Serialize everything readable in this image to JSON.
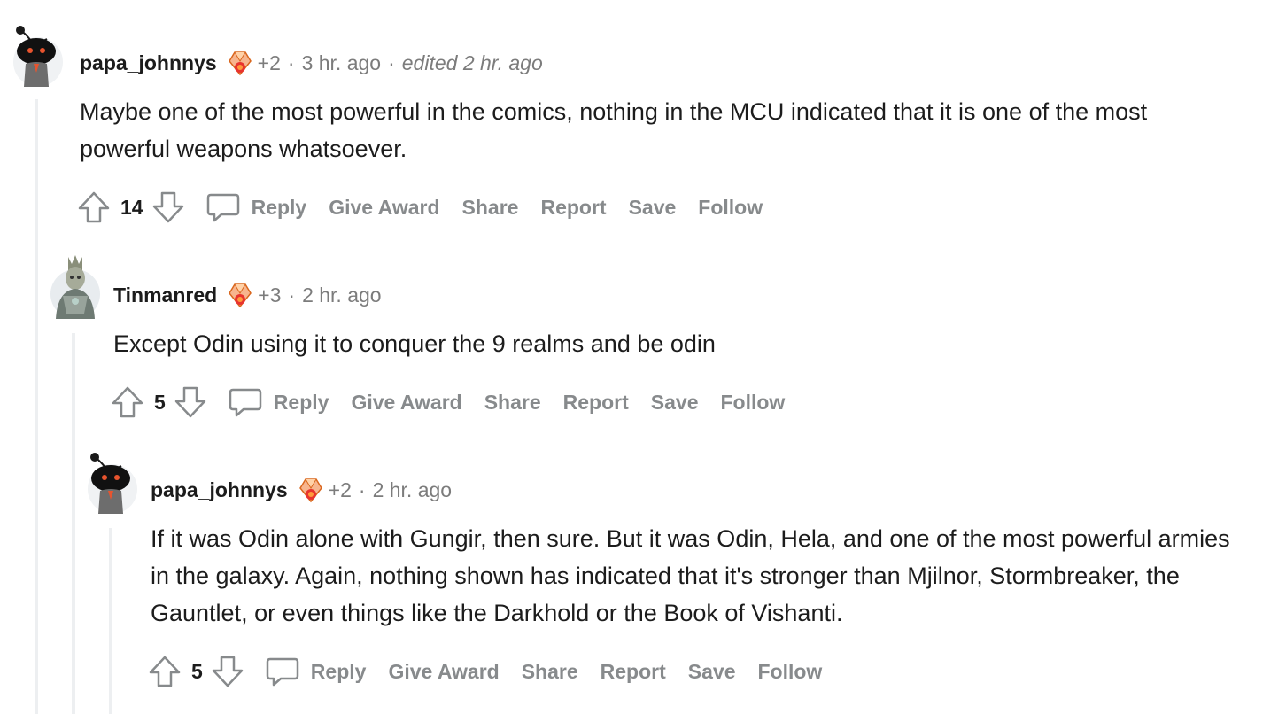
{
  "comments": [
    {
      "username": "papa_johnnys",
      "flair_score": "+2",
      "time": "3 hr. ago",
      "edited": "edited 2 hr. ago",
      "body": "Maybe one of the most powerful in the comics, nothing in the MCU indicated that it is one of the most powerful weapons whatsoever.",
      "score": "14",
      "avatar_icon": "snoo-avatar-icon"
    },
    {
      "username": "Tinmanred",
      "flair_score": "+3",
      "time": "2 hr. ago",
      "edited": "",
      "body": "Except Odin using it to conquer the 9 realms and be odin",
      "score": "5",
      "avatar_icon": "armored-character-avatar-icon"
    },
    {
      "username": "papa_johnnys",
      "flair_score": "+2",
      "time": "2 hr. ago",
      "edited": "",
      "body": "If it was Odin alone with Gungir, then sure. But it was Odin, Hela, and one of the most powerful armies in the galaxy. Again, nothing shown has indicated that it's stronger than Mjilnor, Stormbreaker, the Gauntlet, or even things like the Darkhold or the Book of Vishanti.",
      "score": "5",
      "avatar_icon": "snoo-avatar-icon"
    }
  ],
  "actions": {
    "reply": "Reply",
    "give_award": "Give Award",
    "share": "Share",
    "report": "Report",
    "save": "Save",
    "follow": "Follow"
  },
  "separator": "·",
  "colors": {
    "text": "#1c1c1c",
    "meta": "#7c7c7c",
    "action": "#878a8c",
    "thread_line": "#edeff1"
  }
}
